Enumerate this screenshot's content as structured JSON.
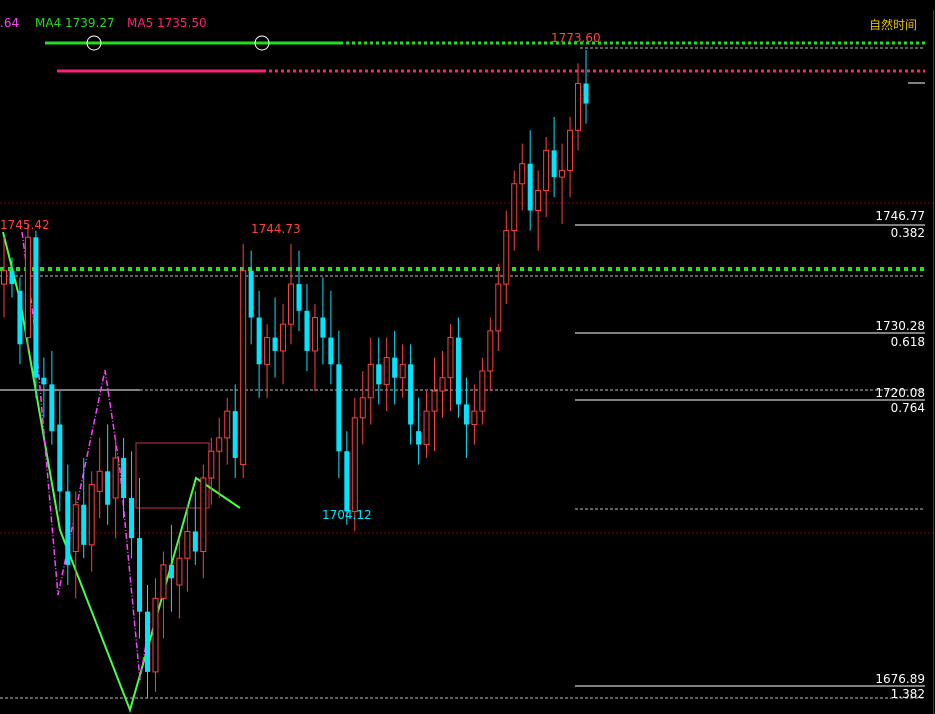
{
  "header": {
    "partial_value": ".64",
    "ma4": "MA4 1739.27",
    "ma5": "MA5 1735.50",
    "corner_label": "自然时间"
  },
  "colors": {
    "up": "#ff4040",
    "down": "#00e5ff",
    "ma_green": "#22dd22",
    "ma_magenta": "#ff1f7a",
    "zigzag": "#44ff44",
    "dashdot": "#ff40ff",
    "fib": "#ffffff"
  },
  "labels": {
    "high_left": "1745.42",
    "high_mid": "1744.73",
    "low_mid": "1704.12",
    "high_top": "1773.60"
  },
  "fib_levels": [
    {
      "price": "1746.77",
      "ratio": "0.382"
    },
    {
      "price": "1730.28",
      "ratio": "0.618"
    },
    {
      "price": "1720.08",
      "ratio": "0.764"
    },
    {
      "price": "1676.89",
      "ratio": "1.382"
    }
  ],
  "chart_data": {
    "type": "candlestick",
    "y_range": [
      1675,
      1777
    ],
    "annotations": [
      {
        "text": "1745.42",
        "price": 1745.42
      },
      {
        "text": "1744.73",
        "price": 1744.73
      },
      {
        "text": "1704.12",
        "price": 1704.12
      },
      {
        "text": "1773.60",
        "price": 1773.6
      }
    ],
    "candles": [
      [
        1739,
        1746,
        1734,
        1741
      ],
      [
        1741,
        1743,
        1737,
        1739
      ],
      [
        1738,
        1740,
        1727,
        1730
      ],
      [
        1731,
        1748,
        1729,
        1746
      ],
      [
        1746,
        1747,
        1722,
        1725
      ],
      [
        1725,
        1728,
        1719,
        1724
      ],
      [
        1724,
        1729,
        1715,
        1717
      ],
      [
        1718,
        1723,
        1705,
        1708
      ],
      [
        1708,
        1712,
        1694,
        1697
      ],
      [
        1699,
        1708,
        1692,
        1706
      ],
      [
        1706,
        1713,
        1698,
        1700
      ],
      [
        1700,
        1711,
        1696,
        1709
      ],
      [
        1708,
        1716,
        1704,
        1711
      ],
      [
        1711,
        1718,
        1703,
        1706
      ],
      [
        1707,
        1716,
        1701,
        1713
      ],
      [
        1713,
        1716,
        1704,
        1707
      ],
      [
        1707,
        1714,
        1698,
        1701
      ],
      [
        1701,
        1710,
        1686,
        1690
      ],
      [
        1690,
        1694,
        1677,
        1681
      ],
      [
        1681,
        1695,
        1678,
        1692
      ],
      [
        1692,
        1699,
        1686,
        1697
      ],
      [
        1697,
        1703,
        1690,
        1695
      ],
      [
        1694,
        1701,
        1689,
        1698
      ],
      [
        1698,
        1706,
        1693,
        1702
      ],
      [
        1702,
        1708,
        1697,
        1699
      ],
      [
        1699,
        1712,
        1695,
        1710
      ],
      [
        1710,
        1716,
        1706,
        1714
      ],
      [
        1714,
        1719,
        1707,
        1716
      ],
      [
        1716,
        1722,
        1712,
        1720
      ],
      [
        1720,
        1724,
        1710,
        1713
      ],
      [
        1712,
        1745,
        1710,
        1741
      ],
      [
        1741,
        1744,
        1730,
        1734
      ],
      [
        1734,
        1738,
        1722,
        1727
      ],
      [
        1727,
        1733,
        1722,
        1731
      ],
      [
        1731,
        1737,
        1725,
        1729
      ],
      [
        1729,
        1736,
        1724,
        1733
      ],
      [
        1733,
        1745,
        1730,
        1739
      ],
      [
        1739,
        1744,
        1732,
        1735
      ],
      [
        1735,
        1739,
        1726,
        1729
      ],
      [
        1729,
        1736,
        1723,
        1734
      ],
      [
        1734,
        1740,
        1727,
        1731
      ],
      [
        1731,
        1738,
        1724,
        1727
      ],
      [
        1727,
        1732,
        1710,
        1714
      ],
      [
        1714,
        1717,
        1703,
        1705
      ],
      [
        1705,
        1722,
        1702,
        1719
      ],
      [
        1719,
        1726,
        1715,
        1722
      ],
      [
        1722,
        1731,
        1718,
        1727
      ],
      [
        1727,
        1731,
        1721,
        1724
      ],
      [
        1724,
        1731,
        1720,
        1728
      ],
      [
        1728,
        1732,
        1721,
        1725
      ],
      [
        1725,
        1730,
        1722,
        1727
      ],
      [
        1727,
        1730,
        1715,
        1718
      ],
      [
        1717,
        1722,
        1712,
        1715
      ],
      [
        1715,
        1723,
        1713,
        1720
      ],
      [
        1720,
        1728,
        1714,
        1723
      ],
      [
        1723,
        1729,
        1719,
        1725
      ],
      [
        1725,
        1733,
        1720,
        1731
      ],
      [
        1731,
        1734,
        1719,
        1721
      ],
      [
        1721,
        1725,
        1713,
        1718
      ],
      [
        1718,
        1724,
        1715,
        1720
      ],
      [
        1720,
        1728,
        1718,
        1726
      ],
      [
        1726,
        1734,
        1723,
        1732
      ],
      [
        1732,
        1742,
        1729,
        1739
      ],
      [
        1739,
        1750,
        1736,
        1747
      ],
      [
        1747,
        1756,
        1744,
        1754
      ],
      [
        1754,
        1760,
        1750,
        1757
      ],
      [
        1757,
        1762,
        1747,
        1750
      ],
      [
        1750,
        1756,
        1744,
        1753
      ],
      [
        1753,
        1761,
        1749,
        1759
      ],
      [
        1759,
        1764,
        1752,
        1755
      ],
      [
        1755,
        1760,
        1748,
        1756
      ],
      [
        1756,
        1764,
        1752,
        1762
      ],
      [
        1762,
        1772,
        1759,
        1769
      ],
      [
        1769,
        1774,
        1763,
        1766
      ]
    ]
  }
}
